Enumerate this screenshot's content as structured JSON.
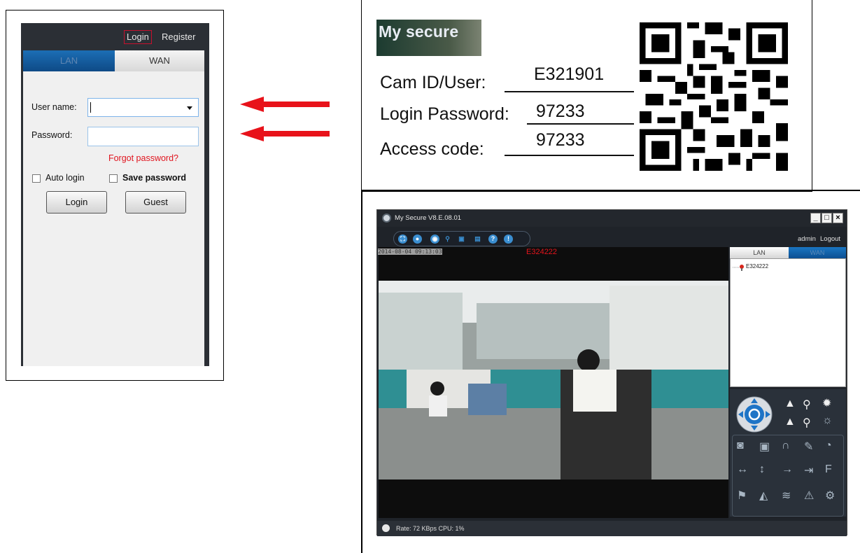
{
  "login": {
    "top_login": "Login",
    "top_register": "Register",
    "tab_lan": "LAN",
    "tab_wan": "WAN",
    "username_label": "User name:",
    "username_value": "",
    "password_label": "Password:",
    "password_value": "",
    "forgot": "Forgot password?",
    "auto_login": "Auto login",
    "save_password": "Save password",
    "login_button": "Login",
    "guest_button": "Guest"
  },
  "card": {
    "logo": "My secure",
    "cam_id_label": "Cam ID/User:",
    "cam_id_value": "E321901",
    "login_password_label": "Login Password:",
    "login_password_value": "97233",
    "access_code_label": "Access code:",
    "access_code_value": "97233"
  },
  "viewer": {
    "title": "My Secure  V8.E.08.01",
    "user": "admin",
    "logout": "Logout",
    "camera_label": "E324222",
    "timestamp": "2014-08-04 09:13:03",
    "tab_lan": "LAN",
    "tab_wan": "WAN",
    "device": "E324222",
    "status": "Rate: 72 KBps  CPU:  1%"
  },
  "colors": {
    "accent_red": "#e0141e",
    "tab_blue": "#1c6eb5"
  }
}
